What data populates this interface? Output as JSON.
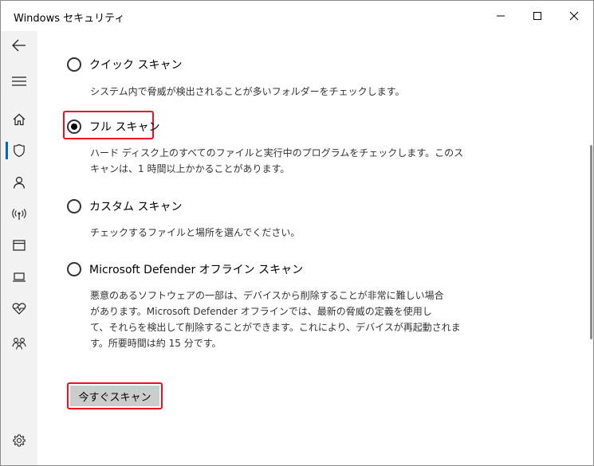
{
  "window": {
    "title": "Windows セキュリティ"
  },
  "sidebar": {
    "items": [
      {
        "icon": "back-arrow-icon"
      },
      {
        "icon": "hamburger-menu-icon"
      },
      {
        "icon": "home-icon"
      },
      {
        "icon": "shield-icon",
        "active": true
      },
      {
        "icon": "person-icon"
      },
      {
        "icon": "wireless-antenna-icon"
      },
      {
        "icon": "app-browser-window-icon"
      },
      {
        "icon": "laptop-icon"
      },
      {
        "icon": "heart-pulse-icon"
      },
      {
        "icon": "family-icon"
      },
      {
        "icon": "gear-icon"
      }
    ]
  },
  "scan_options": [
    {
      "label": "クイック スキャン",
      "checked": false,
      "description": [
        "システム内で脅威が検出されることが多いフォルダーをチェックします。"
      ]
    },
    {
      "label": "フル スキャン",
      "checked": true,
      "description": [
        "ハード ディスク上のすべてのファイルと実行中のプログラムをチェックします。このス",
        "キャンは、1 時間以上かかることがあります。"
      ]
    },
    {
      "label": "カスタム スキャン",
      "checked": false,
      "description": [
        "チェックするファイルと場所を選んでください。"
      ]
    },
    {
      "label": "Microsoft Defender オフライン スキャン",
      "checked": false,
      "description": [
        "悪意のあるソフトウェアの一部は、デバイスから削除することが非常に難しい場合",
        "があります。Microsoft Defender オフラインでは、最新の脅威の定義を使用し",
        "て、それらを検出して削除することができます。これにより、デバイスが再起動されま",
        "す。所要時間は約 15 分です。"
      ]
    }
  ],
  "scan_button": {
    "label": "今すぐスキャン"
  },
  "colors": {
    "highlight": "#e81123",
    "accent": "#0067c0",
    "sidebar_bg": "#f2f2f2",
    "button_bg": "#cccccc"
  }
}
